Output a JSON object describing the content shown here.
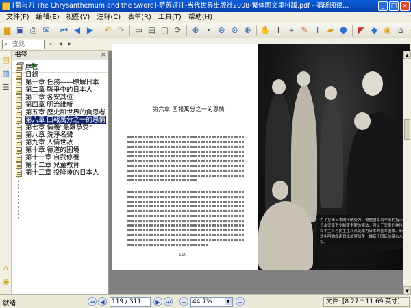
{
  "window": {
    "title": "[菊与刀 The Chrysanthemum and the Sword]-萨苏评注-当代世界出版社2008-繁体图文重排版.pdf - 福昕阅读器 - [[菊与刀 The Chrysanthemum and the Sword]-萨苏..."
  },
  "menu": {
    "items": [
      "文件(F)",
      "编辑(E)",
      "视图(V)",
      "注释(C)",
      "表单(R)",
      "工具(T)",
      "帮助(H)"
    ]
  },
  "search": {
    "placeholder": "查找"
  },
  "bookmarks": {
    "header": "书签",
    "items": [
      {
        "label": "序言"
      },
      {
        "label": "目錄"
      },
      {
        "label": "第一章  任務——瞭解日本"
      },
      {
        "label": "第二章  戰爭中的日本人"
      },
      {
        "label": "第三章  各安其位"
      },
      {
        "label": "第四章  明治維新"
      },
      {
        "label": "第五章  歷史和世界的負恩者"
      },
      {
        "label": "第六章  回報萬分之一的恩情"
      },
      {
        "label": "第七章  情義\"最難承受\""
      },
      {
        "label": "第八章  洗淨名聲"
      },
      {
        "label": "第九章  人情世故"
      },
      {
        "label": "第十章  德道的困境"
      },
      {
        "label": "第十一章  自我修養"
      },
      {
        "label": "第十二章  兒童教育"
      },
      {
        "label": "第十三章  投降後的日本人"
      }
    ],
    "selected_index": 7
  },
  "document": {
    "chapter_title": "第六章  回報萬分之一的恩情",
    "page_number": "110",
    "caption": "为了打击日本的传统势力，根据盟军司令部的指示，日本天皇下令制定全新的宪法，否认了天皇的神性，和平主义与民主主义从此成为日本的基本国策。新宪法中明确规定日本放弃战争，确保了国民的基本人权。"
  },
  "status": {
    "ready": "就绪",
    "page_field": "119 / 311",
    "zoom": "44.7%",
    "page_size": "文件: [8.27 * 11.69 英寸]"
  }
}
